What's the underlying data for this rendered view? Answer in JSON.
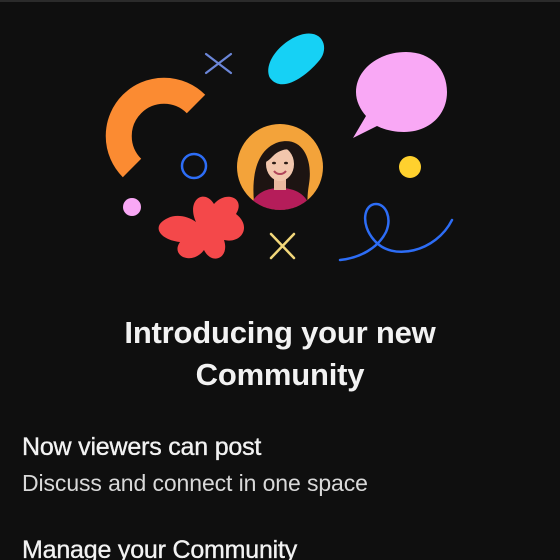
{
  "dialog": {
    "title_line1": "Introducing your new",
    "title_line2": "Community",
    "features": [
      {
        "heading": "Now viewers can post",
        "description": "Discuss and connect in one space"
      },
      {
        "heading": "Manage your Community"
      }
    ]
  },
  "illustration": {
    "avatar_icon": "creator-avatar",
    "shape_icons": [
      "orange-arc-icon",
      "blue-cross-icon",
      "cyan-blob-icon",
      "pink-speech-bubble-icon",
      "blue-ring-icon",
      "yellow-dot-icon",
      "pink-dot-icon",
      "red-flower-icon",
      "yellow-cross-icon",
      "blue-squiggle-icon"
    ],
    "colors": {
      "orange": "#fb8b32",
      "cyan": "#16d1f5",
      "pink": "#f9a8f5",
      "blue": "#2d6df6",
      "yellow": "#ffd12e",
      "red": "#f4484a",
      "avatar_bg": "#f3a33a",
      "background": "#0f0f0f"
    }
  }
}
